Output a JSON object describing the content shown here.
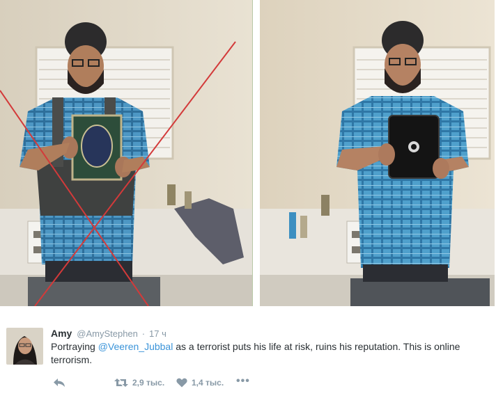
{
  "media": {
    "left_photo": "photo-selfie-with-vest-and-book-crossed-out",
    "right_photo": "photo-selfie-with-tablet"
  },
  "tweet": {
    "author_name": "Amy",
    "author_handle": "@AmyStephen",
    "separator": "·",
    "time": "17 ч",
    "text_prefix": "Portraying ",
    "mention": "@Veeren_Jubbal",
    "text_suffix": " as a terrorist puts his life at risk, ruins his reputation. This is online terrorism."
  },
  "actions": {
    "reply_icon": "reply-icon",
    "retweet_icon": "retweet-icon",
    "retweet_count": "2,9 тыс.",
    "like_icon": "heart-icon",
    "like_count": "1,4 тыс.",
    "more_label": "•••"
  },
  "colors": {
    "text": "#292f33",
    "muted": "#8899a6",
    "link": "#3b94d9",
    "cross": "#d33a3a"
  }
}
